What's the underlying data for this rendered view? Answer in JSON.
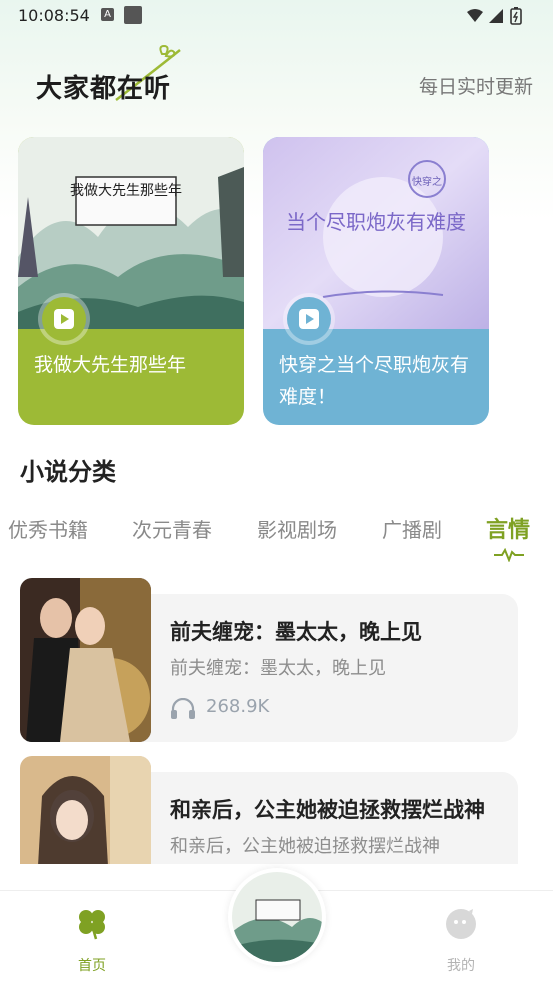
{
  "status_bar": {
    "time": "10:08:54",
    "a_icon": "A"
  },
  "header": {
    "title": "大家都在听",
    "subtitle": "每日实时更新"
  },
  "featured": [
    {
      "title": "我做大先生那些年",
      "cover_text": "我做大先生那些年",
      "color": "#9dba36"
    },
    {
      "title": "快穿之当个尽职炮灰有难度！",
      "cover_text": "当个尽职炮灰有难度",
      "cover_badge": "快穿之",
      "color": "#6fb3d4"
    }
  ],
  "section": {
    "title": "小说分类"
  },
  "tabs": [
    "优秀书籍",
    "次元青春",
    "影视剧场",
    "广播剧",
    "言情"
  ],
  "active_tab": "言情",
  "books": [
    {
      "title": "前夫缠宠：墨太太，晚上见",
      "desc": "前夫缠宠：墨太太，晚上见",
      "plays": "268.9K"
    },
    {
      "title": "和亲后，公主她被迫拯救摆烂战神",
      "desc": "和亲后，公主她被迫拯救摆烂战神",
      "plays": ""
    }
  ],
  "bottom_nav": {
    "home_label": "首页",
    "mine_label": "我的"
  },
  "colors": {
    "accent": "#7fa123",
    "card_green": "#9dba36",
    "card_blue": "#6fb3d4"
  }
}
